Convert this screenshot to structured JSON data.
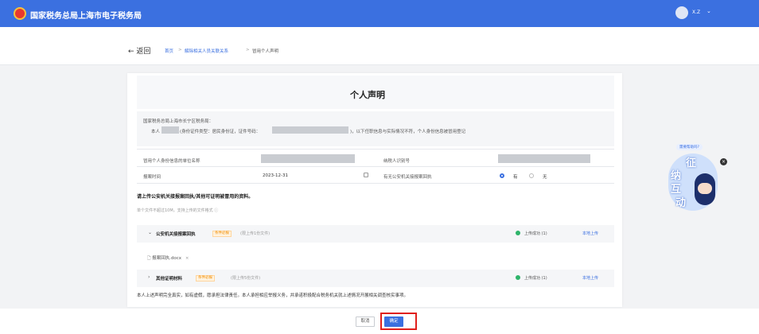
{
  "header": {
    "title": "国家税务总局上海市电子税务局",
    "user_name": "X.Z",
    "user_chevron": "⌄"
  },
  "subnav": {
    "back_label": "← 返回",
    "breadcrumb": [
      "首页",
      "解除相关人员关联关系",
      "冒用个人声明"
    ],
    "separator": ">"
  },
  "card": {
    "title": "个人声明",
    "info": {
      "line1": "国家税务总局上海市长宁区税务局：",
      "line2_a": "本人",
      "line2_b": "(身份证件类型：居民身份证，证件号码：",
      "line2_c": ")，以下任职信息与实际情况不符，个人身份信息被冒用登记"
    },
    "table": {
      "row1_label": "冒用个人身份信息的单位名称",
      "row1_label2": "纳税人识别号",
      "row2_label": "报案时间",
      "row2_value": "2023-12-31",
      "row2_label2": "有无公安机关接报案回执",
      "radio_yes": "有",
      "radio_no": "无"
    },
    "upload": {
      "title": "请上传公安机关接报案回执/其他可证明被冒用的资料。",
      "hint": "单个文件不超过10M，支持上传的文件格式 ⓘ",
      "sections": [
        {
          "chevron": "⌄",
          "name": "公安机关接报案回执",
          "tag": "条件必报",
          "limit": "(限上传1份文件)",
          "status": "上传成功 (1)",
          "action": "本地上传"
        },
        {
          "chevron": "›",
          "name": "其他证明材料",
          "tag": "条件必报",
          "limit": "(限上传5份文件)",
          "status": "上传成功 (1)",
          "action": "本地上传"
        }
      ],
      "file_name": "🗋 报案回执.docx",
      "file_remove": "×"
    },
    "declaration": "本人上述声明完全真实，如有虚假，愿承担法律责任。本人承担相应举报义务，并承诺积极配合税务机关就上述情况开展相关调查核实事项。"
  },
  "footer": {
    "cancel_label": "取消",
    "ok_label": "确定"
  },
  "mascot": {
    "bubble": "需要帮助吗?",
    "chars": [
      "征",
      "纳",
      "互",
      "动"
    ],
    "close": "×"
  },
  "colors": {
    "primary": "#3b70e0",
    "success": "#2fb46a",
    "warning": "#f08c00",
    "highlight": "#e0201c"
  }
}
